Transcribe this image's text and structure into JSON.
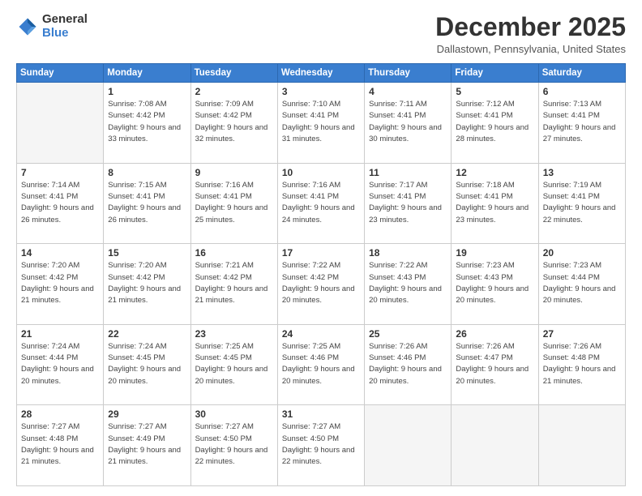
{
  "logo": {
    "general": "General",
    "blue": "Blue"
  },
  "header": {
    "month": "December 2025",
    "location": "Dallastown, Pennsylvania, United States"
  },
  "days_of_week": [
    "Sunday",
    "Monday",
    "Tuesday",
    "Wednesday",
    "Thursday",
    "Friday",
    "Saturday"
  ],
  "weeks": [
    [
      {
        "day": "",
        "empty": true
      },
      {
        "day": "1",
        "sunrise": "Sunrise: 7:08 AM",
        "sunset": "Sunset: 4:42 PM",
        "daylight": "Daylight: 9 hours and 33 minutes."
      },
      {
        "day": "2",
        "sunrise": "Sunrise: 7:09 AM",
        "sunset": "Sunset: 4:42 PM",
        "daylight": "Daylight: 9 hours and 32 minutes."
      },
      {
        "day": "3",
        "sunrise": "Sunrise: 7:10 AM",
        "sunset": "Sunset: 4:41 PM",
        "daylight": "Daylight: 9 hours and 31 minutes."
      },
      {
        "day": "4",
        "sunrise": "Sunrise: 7:11 AM",
        "sunset": "Sunset: 4:41 PM",
        "daylight": "Daylight: 9 hours and 30 minutes."
      },
      {
        "day": "5",
        "sunrise": "Sunrise: 7:12 AM",
        "sunset": "Sunset: 4:41 PM",
        "daylight": "Daylight: 9 hours and 28 minutes."
      },
      {
        "day": "6",
        "sunrise": "Sunrise: 7:13 AM",
        "sunset": "Sunset: 4:41 PM",
        "daylight": "Daylight: 9 hours and 27 minutes."
      }
    ],
    [
      {
        "day": "7",
        "sunrise": "Sunrise: 7:14 AM",
        "sunset": "Sunset: 4:41 PM",
        "daylight": "Daylight: 9 hours and 26 minutes."
      },
      {
        "day": "8",
        "sunrise": "Sunrise: 7:15 AM",
        "sunset": "Sunset: 4:41 PM",
        "daylight": "Daylight: 9 hours and 26 minutes."
      },
      {
        "day": "9",
        "sunrise": "Sunrise: 7:16 AM",
        "sunset": "Sunset: 4:41 PM",
        "daylight": "Daylight: 9 hours and 25 minutes."
      },
      {
        "day": "10",
        "sunrise": "Sunrise: 7:16 AM",
        "sunset": "Sunset: 4:41 PM",
        "daylight": "Daylight: 9 hours and 24 minutes."
      },
      {
        "day": "11",
        "sunrise": "Sunrise: 7:17 AM",
        "sunset": "Sunset: 4:41 PM",
        "daylight": "Daylight: 9 hours and 23 minutes."
      },
      {
        "day": "12",
        "sunrise": "Sunrise: 7:18 AM",
        "sunset": "Sunset: 4:41 PM",
        "daylight": "Daylight: 9 hours and 23 minutes."
      },
      {
        "day": "13",
        "sunrise": "Sunrise: 7:19 AM",
        "sunset": "Sunset: 4:41 PM",
        "daylight": "Daylight: 9 hours and 22 minutes."
      }
    ],
    [
      {
        "day": "14",
        "sunrise": "Sunrise: 7:20 AM",
        "sunset": "Sunset: 4:42 PM",
        "daylight": "Daylight: 9 hours and 21 minutes."
      },
      {
        "day": "15",
        "sunrise": "Sunrise: 7:20 AM",
        "sunset": "Sunset: 4:42 PM",
        "daylight": "Daylight: 9 hours and 21 minutes."
      },
      {
        "day": "16",
        "sunrise": "Sunrise: 7:21 AM",
        "sunset": "Sunset: 4:42 PM",
        "daylight": "Daylight: 9 hours and 21 minutes."
      },
      {
        "day": "17",
        "sunrise": "Sunrise: 7:22 AM",
        "sunset": "Sunset: 4:42 PM",
        "daylight": "Daylight: 9 hours and 20 minutes."
      },
      {
        "day": "18",
        "sunrise": "Sunrise: 7:22 AM",
        "sunset": "Sunset: 4:43 PM",
        "daylight": "Daylight: 9 hours and 20 minutes."
      },
      {
        "day": "19",
        "sunrise": "Sunrise: 7:23 AM",
        "sunset": "Sunset: 4:43 PM",
        "daylight": "Daylight: 9 hours and 20 minutes."
      },
      {
        "day": "20",
        "sunrise": "Sunrise: 7:23 AM",
        "sunset": "Sunset: 4:44 PM",
        "daylight": "Daylight: 9 hours and 20 minutes."
      }
    ],
    [
      {
        "day": "21",
        "sunrise": "Sunrise: 7:24 AM",
        "sunset": "Sunset: 4:44 PM",
        "daylight": "Daylight: 9 hours and 20 minutes."
      },
      {
        "day": "22",
        "sunrise": "Sunrise: 7:24 AM",
        "sunset": "Sunset: 4:45 PM",
        "daylight": "Daylight: 9 hours and 20 minutes."
      },
      {
        "day": "23",
        "sunrise": "Sunrise: 7:25 AM",
        "sunset": "Sunset: 4:45 PM",
        "daylight": "Daylight: 9 hours and 20 minutes."
      },
      {
        "day": "24",
        "sunrise": "Sunrise: 7:25 AM",
        "sunset": "Sunset: 4:46 PM",
        "daylight": "Daylight: 9 hours and 20 minutes."
      },
      {
        "day": "25",
        "sunrise": "Sunrise: 7:26 AM",
        "sunset": "Sunset: 4:46 PM",
        "daylight": "Daylight: 9 hours and 20 minutes."
      },
      {
        "day": "26",
        "sunrise": "Sunrise: 7:26 AM",
        "sunset": "Sunset: 4:47 PM",
        "daylight": "Daylight: 9 hours and 20 minutes."
      },
      {
        "day": "27",
        "sunrise": "Sunrise: 7:26 AM",
        "sunset": "Sunset: 4:48 PM",
        "daylight": "Daylight: 9 hours and 21 minutes."
      }
    ],
    [
      {
        "day": "28",
        "sunrise": "Sunrise: 7:27 AM",
        "sunset": "Sunset: 4:48 PM",
        "daylight": "Daylight: 9 hours and 21 minutes."
      },
      {
        "day": "29",
        "sunrise": "Sunrise: 7:27 AM",
        "sunset": "Sunset: 4:49 PM",
        "daylight": "Daylight: 9 hours and 21 minutes."
      },
      {
        "day": "30",
        "sunrise": "Sunrise: 7:27 AM",
        "sunset": "Sunset: 4:50 PM",
        "daylight": "Daylight: 9 hours and 22 minutes."
      },
      {
        "day": "31",
        "sunrise": "Sunrise: 7:27 AM",
        "sunset": "Sunset: 4:50 PM",
        "daylight": "Daylight: 9 hours and 22 minutes."
      },
      {
        "day": "",
        "empty": true
      },
      {
        "day": "",
        "empty": true
      },
      {
        "day": "",
        "empty": true
      }
    ]
  ]
}
